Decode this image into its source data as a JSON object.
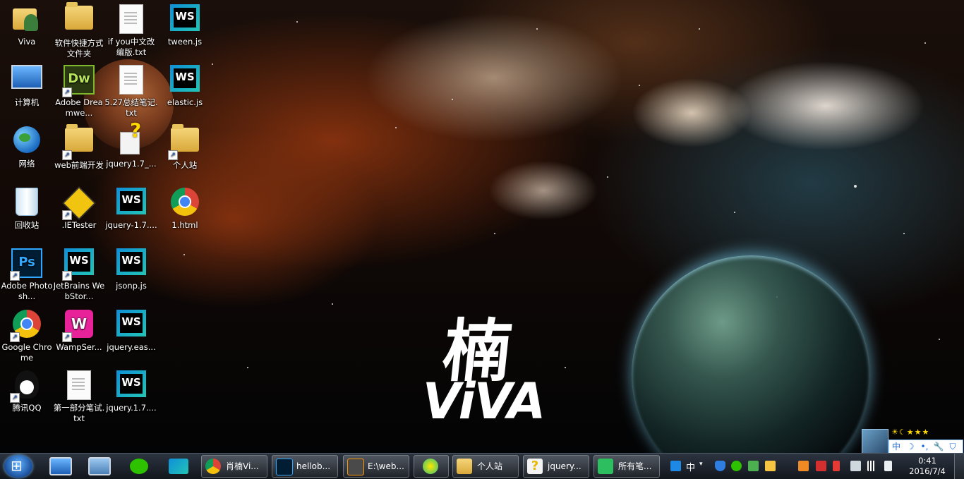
{
  "desktop": {
    "icons": [
      {
        "label": "Viva"
      },
      {
        "label": "软件快捷方式文件夹"
      },
      {
        "label": "if you中文改编版.txt"
      },
      {
        "label": "tween.js"
      },
      {
        "label": "计算机"
      },
      {
        "label": "Adobe Dreamwe..."
      },
      {
        "label": "5.27总结笔记.txt"
      },
      {
        "label": "elastic.js"
      },
      {
        "label": "网络"
      },
      {
        "label": "web前端开发"
      },
      {
        "label": "jquery1.7_..."
      },
      {
        "label": "个人站"
      },
      {
        "label": "回收站"
      },
      {
        "label": ".IETester"
      },
      {
        "label": "jquery-1.7...."
      },
      {
        "label": "1.html"
      },
      {
        "label": "Adobe Photosh..."
      },
      {
        "label": "JetBrains WebStor..."
      },
      {
        "label": "jsonp.js"
      },
      {
        "label": "Google Chrome"
      },
      {
        "label": "WampSer..."
      },
      {
        "label": "jquery.eas..."
      },
      {
        "label": "腾讯QQ"
      },
      {
        "label": "第一部分笔试.txt"
      },
      {
        "label": "jquery.1.7...."
      }
    ],
    "wallpaper": {
      "char": "楠",
      "word": "ViVA"
    }
  },
  "taskbar": {
    "pinned": [
      {
        "icon": "desktop-icon"
      },
      {
        "icon": "window-switch-icon"
      },
      {
        "icon": "wechat-icon"
      },
      {
        "icon": "webstorm-icon"
      }
    ],
    "windows": [
      {
        "label": "肖楠Vi...",
        "icon": "chrome-icon"
      },
      {
        "label": "hellob...",
        "icon": "photoshop-icon"
      },
      {
        "label": "E:\\web...",
        "icon": "sublime-icon"
      },
      {
        "label": "",
        "icon": "qqmusic-icon"
      },
      {
        "label": "个人站",
        "icon": "folder-icon"
      },
      {
        "label": "jquery...",
        "icon": "help-file-icon"
      },
      {
        "label": "所有笔...",
        "icon": "evernote-icon"
      }
    ],
    "tray": {
      "ime_label": "中",
      "clock_time": "0:41",
      "clock_date": "2016/7/4"
    },
    "ime_bar": {
      "stars": "☀☾★★★",
      "keys": [
        "中",
        "☽",
        "•,",
        "🔧",
        "⛉"
      ]
    }
  },
  "colors": {
    "taskbar": "#1c222b",
    "accent": "#1a6be0"
  }
}
